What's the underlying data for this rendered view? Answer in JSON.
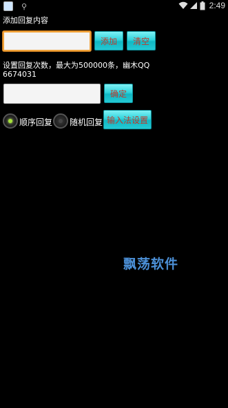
{
  "status_bar": {
    "time": "2:49",
    "icons": [
      "app-icon",
      "usb-icon",
      "wifi-icon",
      "signal-icon",
      "battery-icon"
    ]
  },
  "reply_section": {
    "label": "添加回复内容",
    "input_value": "",
    "add_button": "添加",
    "clear_button": "清空"
  },
  "count_section": {
    "label_line1": "设置回复次数，最大为500000条，幽木QQ",
    "label_line2": "6674031",
    "input_value": "",
    "confirm_button": "确定"
  },
  "mode": {
    "sequential_label": "顺序回复",
    "random_label": "随机回复",
    "selected": "sequential",
    "ime_button": "输入法设置"
  },
  "watermark": "飘荡软件",
  "colors": {
    "accent": "#2fd3dc",
    "button_text": "#c0392b",
    "focus_border": "#f0a23a",
    "watermark": "#4b8fd6"
  }
}
